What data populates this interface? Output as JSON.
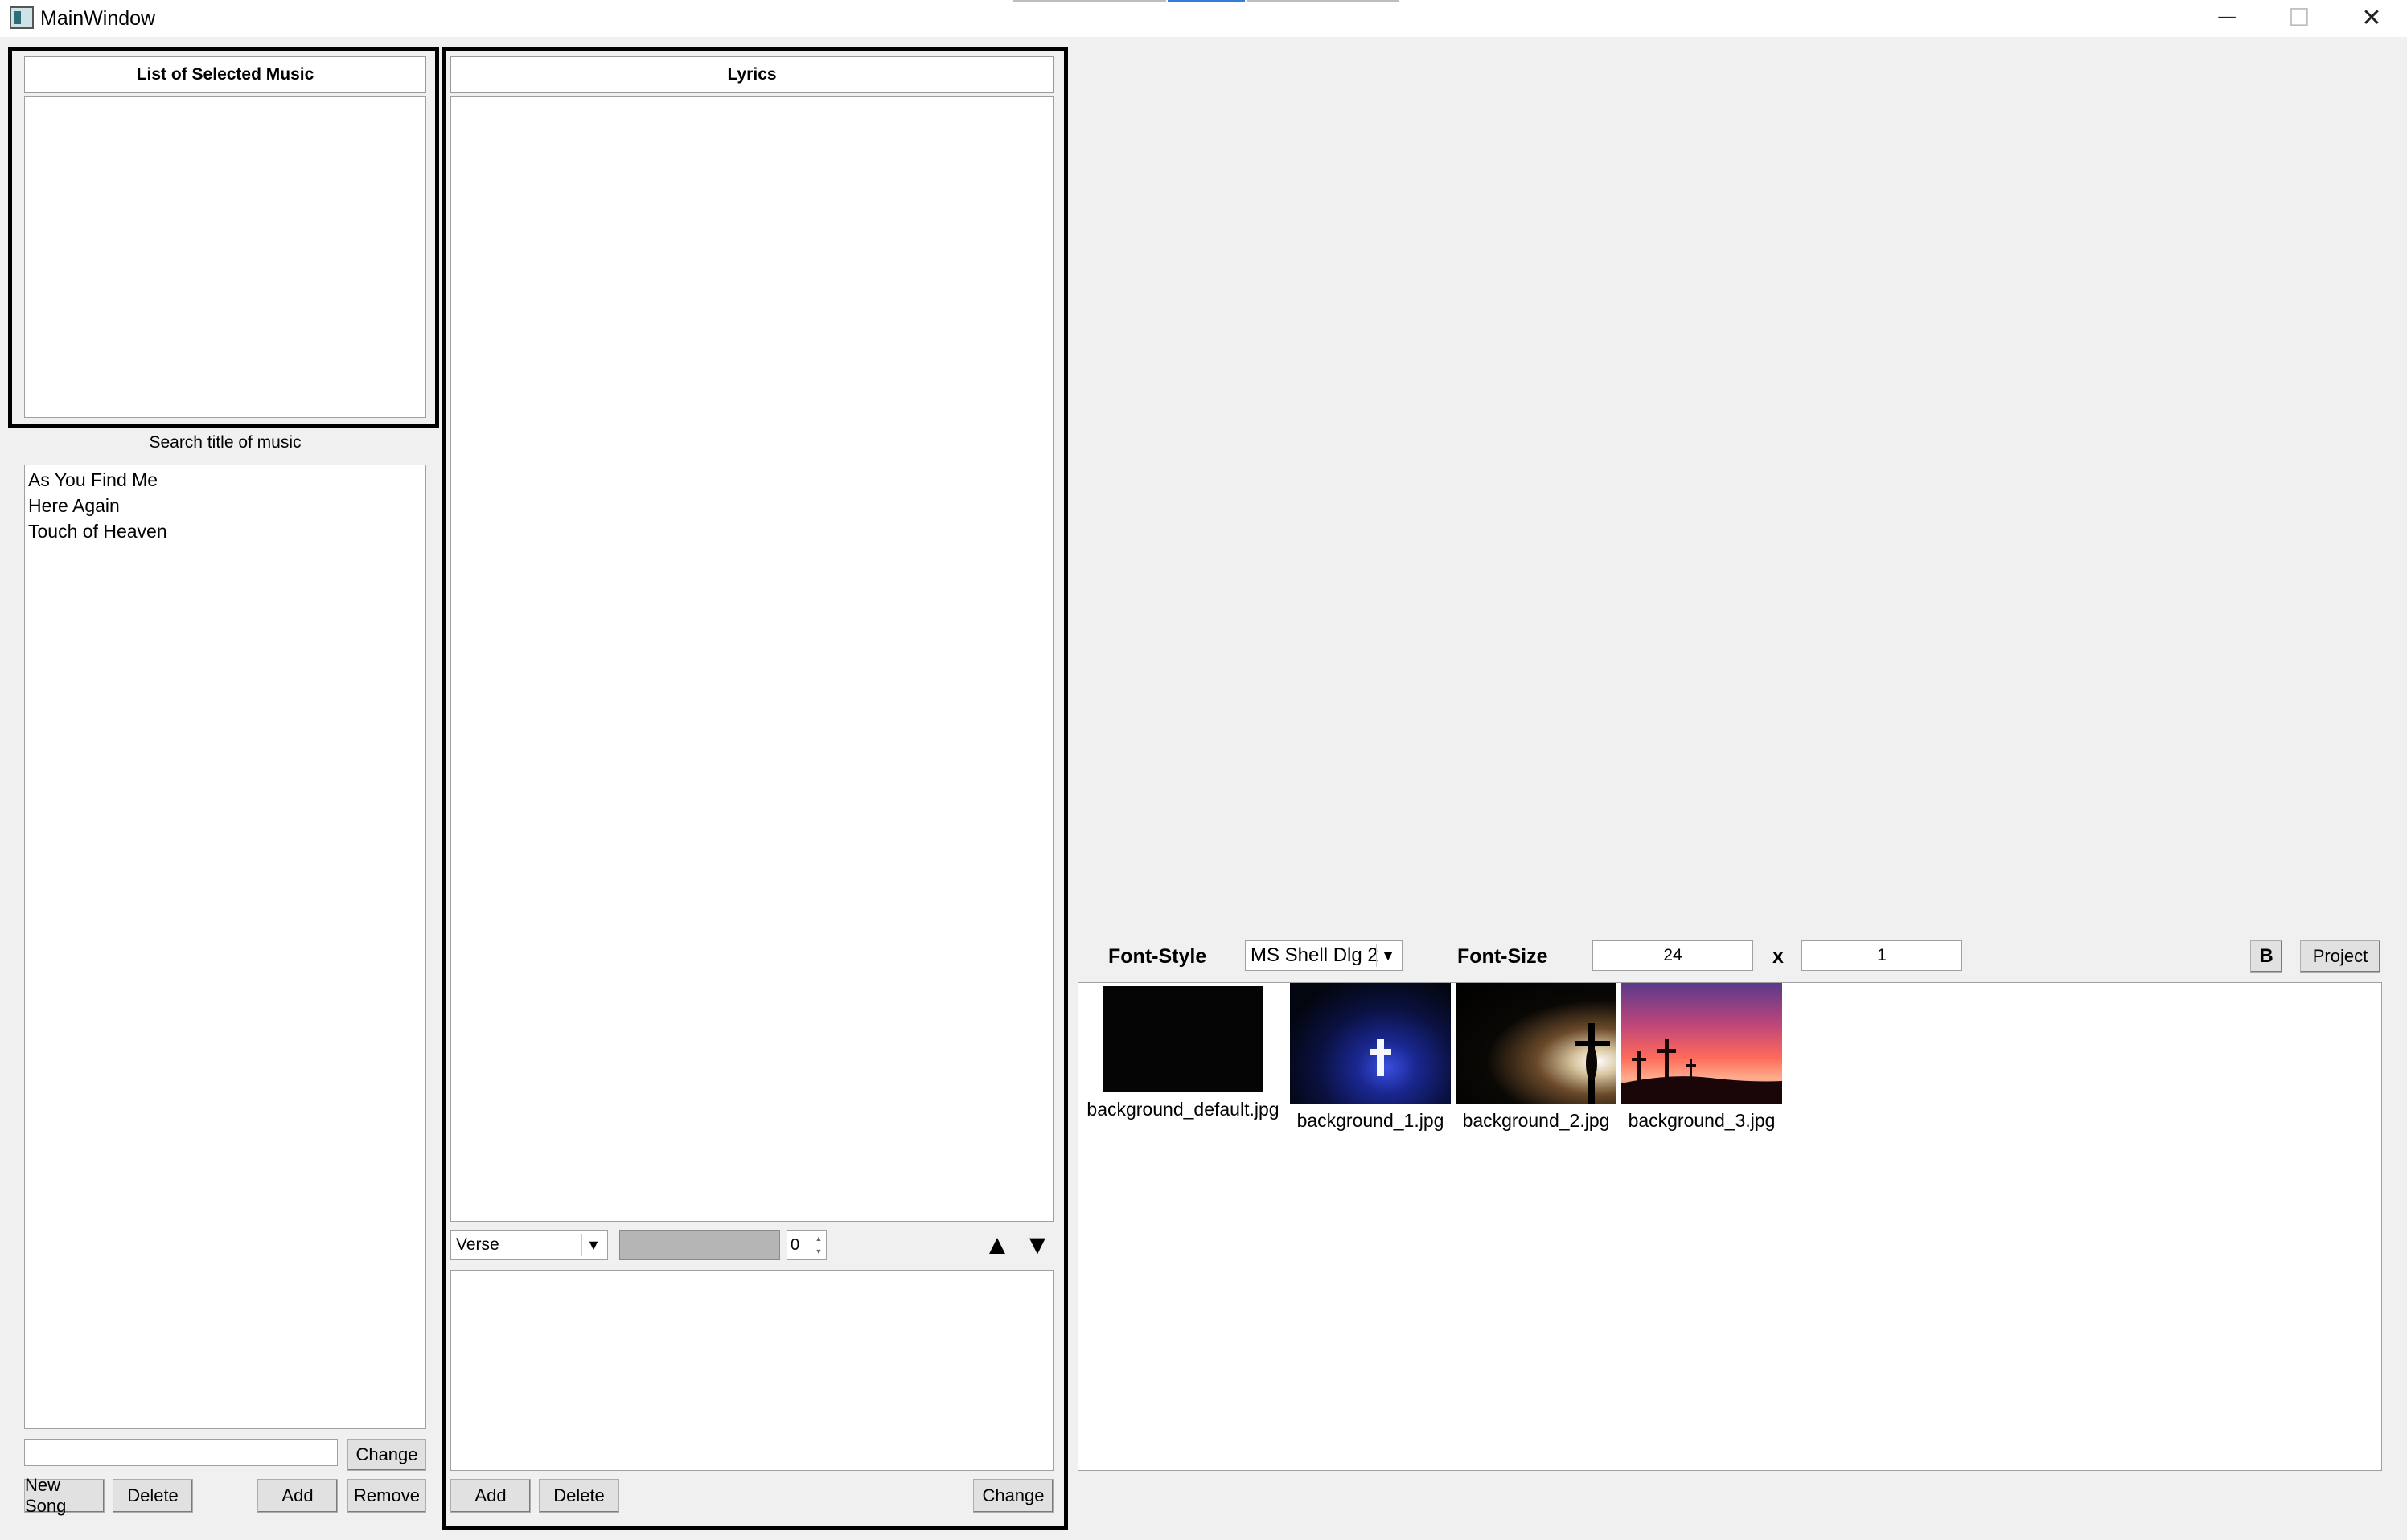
{
  "window": {
    "title": "MainWindow",
    "minimize": "─",
    "maximize": "☐",
    "close": "✕"
  },
  "selected_music": {
    "header": "List of Selected Music",
    "items": []
  },
  "search": {
    "label": "Search title of music",
    "results": [
      "As You Find Me",
      "Here Again",
      "Touch of Heaven"
    ],
    "edit_value": ""
  },
  "left_buttons": {
    "change": "Change",
    "new_song": "New Song",
    "delete": "Delete",
    "add": "Add",
    "remove": "Remove"
  },
  "lyrics": {
    "header": "Lyrics",
    "section_type": "Verse",
    "section_number": "0",
    "up_arrow": "▲",
    "down_arrow": "▼",
    "buttons": {
      "add": "Add",
      "delete": "Delete",
      "change": "Change"
    }
  },
  "font": {
    "style_label": "Font-Style",
    "style_value": "MS Shell Dlg 2",
    "size_label": "Font-Size",
    "size_value": "24",
    "multiplier_label": "x",
    "multiplier_value": "1",
    "bold_button": "B",
    "project_button": "Project"
  },
  "backgrounds": [
    {
      "name": "background_default.jpg",
      "icon": "black-image"
    },
    {
      "name": "background_1.jpg",
      "icon": "glowing-blue-cross-image"
    },
    {
      "name": "background_2.jpg",
      "icon": "crucifix-silhouette-image"
    },
    {
      "name": "background_3.jpg",
      "icon": "three-crosses-sunset-image"
    }
  ],
  "colors": {
    "window_bg": "#f0f0f0",
    "panel_border": "#000000",
    "list_bg": "#ffffff"
  }
}
